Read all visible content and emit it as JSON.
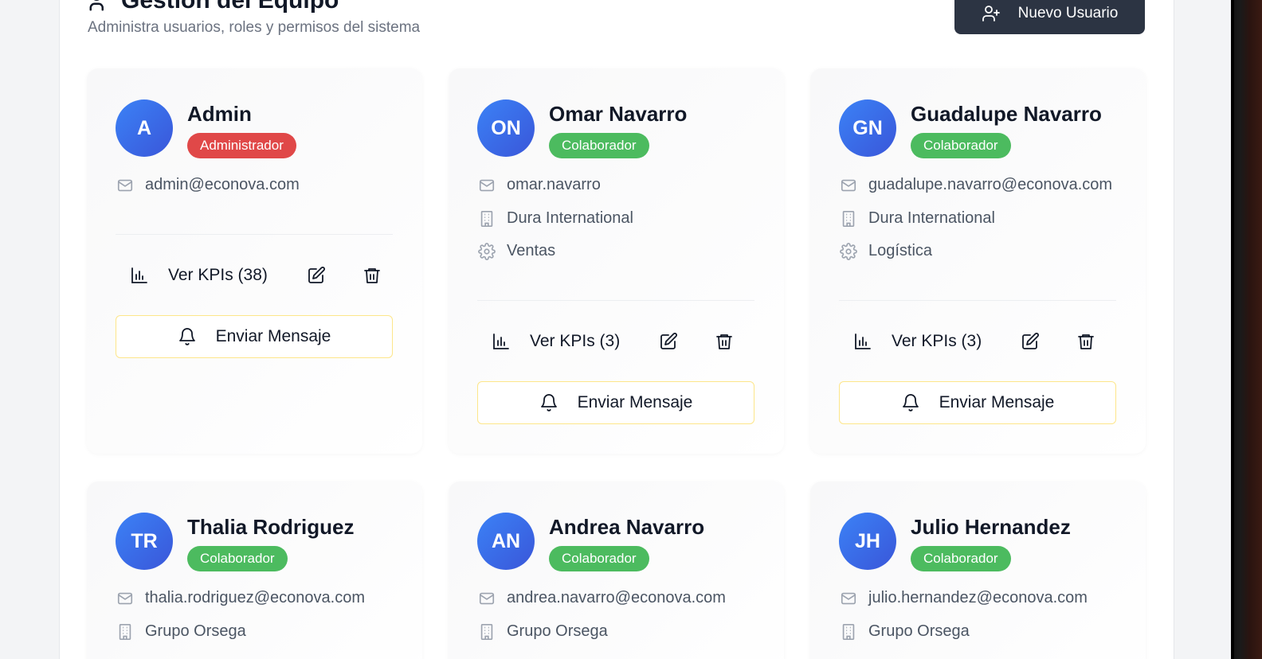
{
  "header": {
    "title": "Gestión del Equipo",
    "subtitle": "Administra usuarios, roles y permisos del sistema",
    "new_user_label": "Nuevo Usuario"
  },
  "colors": {
    "admin_badge": "#e04848",
    "collab_badge": "#4cbb5f",
    "avatar_blue": "#3b6ae6",
    "button_dark": "#2c3443",
    "message_border": "#fde68a"
  },
  "users": [
    {
      "initials": "A",
      "name": "Admin",
      "role": "Administrador",
      "email": "admin@econova.com",
      "company": "",
      "department": "",
      "kpi_label": "Ver KPIs (38)",
      "message_label": "Enviar Mensaje"
    },
    {
      "initials": "ON",
      "name": "Omar Navarro",
      "role": "Colaborador",
      "email": "omar.navarro",
      "company": "Dura International",
      "department": "Ventas",
      "kpi_label": "Ver KPIs (3)",
      "message_label": "Enviar Mensaje"
    },
    {
      "initials": "GN",
      "name": "Guadalupe Navarro",
      "role": "Colaborador",
      "email": "guadalupe.navarro@econova.com",
      "company": "Dura International",
      "department": "Logística",
      "kpi_label": "Ver KPIs (3)",
      "message_label": "Enviar Mensaje"
    },
    {
      "initials": "TR",
      "name": "Thalia Rodriguez",
      "role": "Colaborador",
      "email": "thalia.rodriguez@econova.com",
      "company": "Grupo Orsega"
    },
    {
      "initials": "AN",
      "name": "Andrea Navarro",
      "role": "Colaborador",
      "email": "andrea.navarro@econova.com",
      "company": "Grupo Orsega"
    },
    {
      "initials": "JH",
      "name": "Julio Hernandez",
      "role": "Colaborador",
      "email": "julio.hernandez@econova.com",
      "company": "Grupo Orsega"
    }
  ]
}
